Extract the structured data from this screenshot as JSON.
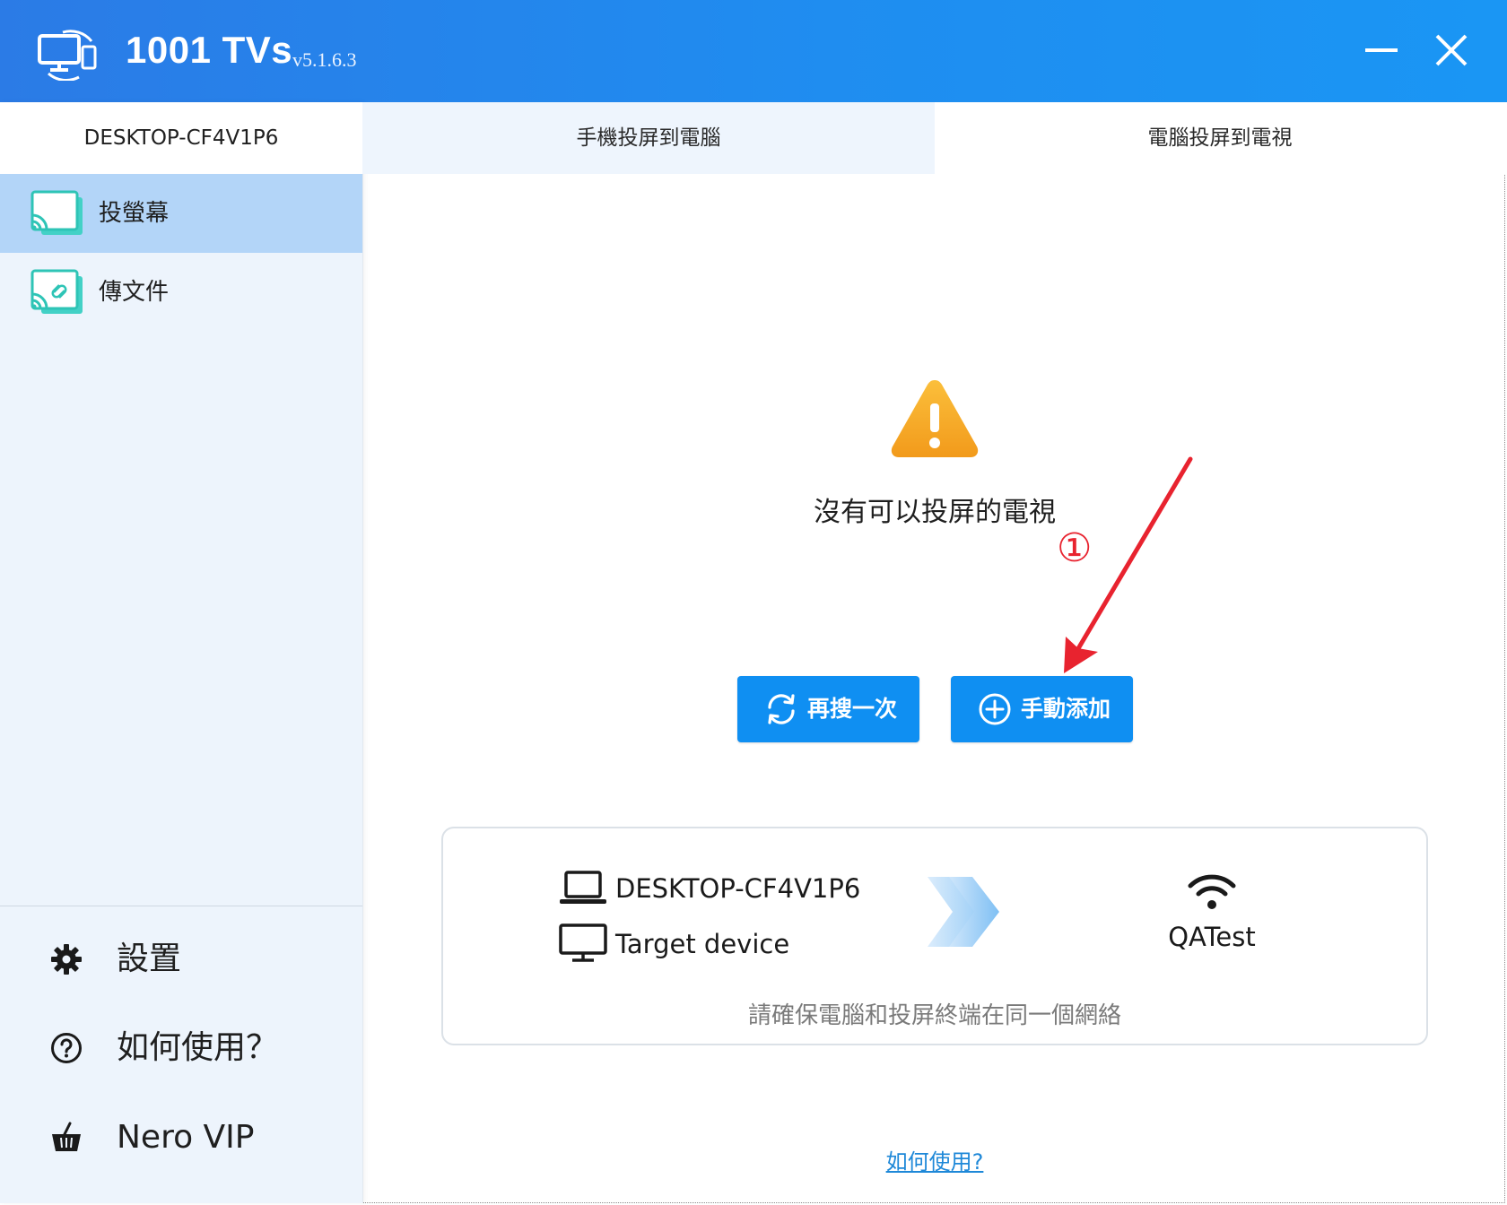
{
  "titlebar": {
    "app_name": "1001 TVs",
    "version": "v5.1.6.3"
  },
  "sidebar": {
    "device_name": "DESKTOP-CF4V1P6",
    "items": [
      {
        "label": "投螢幕",
        "icon": "screen-cast-icon",
        "active": true
      },
      {
        "label": "傳文件",
        "icon": "file-transfer-icon",
        "active": false
      }
    ],
    "bottom_items": [
      {
        "label": "設置",
        "icon": "gear-icon"
      },
      {
        "label": "如何使用？",
        "icon": "question-circle-icon"
      },
      {
        "label": "Nero VIP",
        "icon": "basket-icon"
      }
    ]
  },
  "tabs": [
    {
      "label": "手機投屏到電腦",
      "active": false
    },
    {
      "label": "電腦投屏到電視",
      "active": true
    }
  ],
  "main": {
    "empty_message": "沒有可以投屏的電視",
    "annotation_number": "①",
    "buttons": {
      "retry_label": "再搜一次",
      "add_label": "手動添加"
    },
    "info_card": {
      "computer_name": "DESKTOP-CF4V1P6",
      "target_label": "Target device",
      "network_name": "QATest",
      "hint": "請確保電腦和投屏終端在同一個網絡"
    },
    "help_link": "如何使用?"
  },
  "colors": {
    "titlebar": "#1f8df0",
    "accent_button": "#0f8ff2",
    "sidebar_bg": "#edf4fc",
    "sidebar_active": "#b3d5f8",
    "warning": "#f5a623",
    "annotation": "#e8232f",
    "link": "#1e88d8"
  }
}
